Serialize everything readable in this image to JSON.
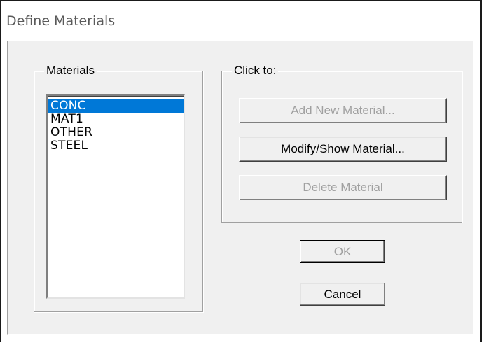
{
  "window": {
    "title": "Define Materials"
  },
  "materials_group": {
    "label": "Materials",
    "items": [
      "CONC",
      "MAT1",
      "OTHER",
      "STEEL"
    ],
    "selected_index": 0
  },
  "click_to_group": {
    "label": "Click to:",
    "add_label": "Add New Material...",
    "modify_label": "Modify/Show Material...",
    "delete_label": "Delete Material"
  },
  "buttons": {
    "ok_label": "OK",
    "cancel_label": "Cancel"
  },
  "colors": {
    "selection": "#0078d7",
    "face": "#f0f0f0",
    "disabled_text": "#a0a0a0"
  }
}
